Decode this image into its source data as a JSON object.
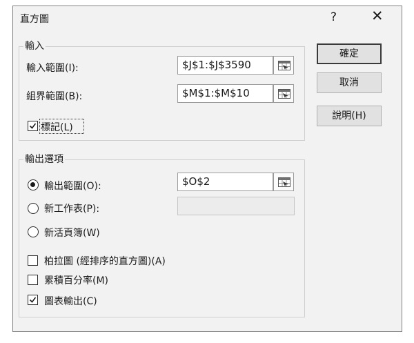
{
  "dialog": {
    "title": "直方圖",
    "help_glyph": "?",
    "close_glyph": "✕"
  },
  "input_group": {
    "label": "輸入",
    "input_range": {
      "label": "輸入範圍(I):",
      "value": "$J$1:$J$3590"
    },
    "bin_range": {
      "label": "組界範圍(B):",
      "value": "$M$1:$M$10"
    },
    "labels_checkbox": {
      "label": "標記(L)",
      "checked": true
    }
  },
  "output_group": {
    "label": "輸出選項",
    "output_range": {
      "label": "輸出範圍(O):",
      "value": "$O$2",
      "selected": true
    },
    "new_worksheet": {
      "label": "新工作表(P):",
      "value": "",
      "selected": false
    },
    "new_workbook": {
      "label": "新活頁簿(W)",
      "selected": false
    },
    "pareto": {
      "label": "柏拉圖 (經排序的直方圖)(A)",
      "checked": false
    },
    "cumulative_percentage": {
      "label": "累積百分率(M)",
      "checked": false
    },
    "chart_output": {
      "label": "圖表輸出(C)",
      "checked": true
    }
  },
  "buttons": {
    "ok": "確定",
    "cancel": "取消",
    "help": "說明(H)"
  }
}
